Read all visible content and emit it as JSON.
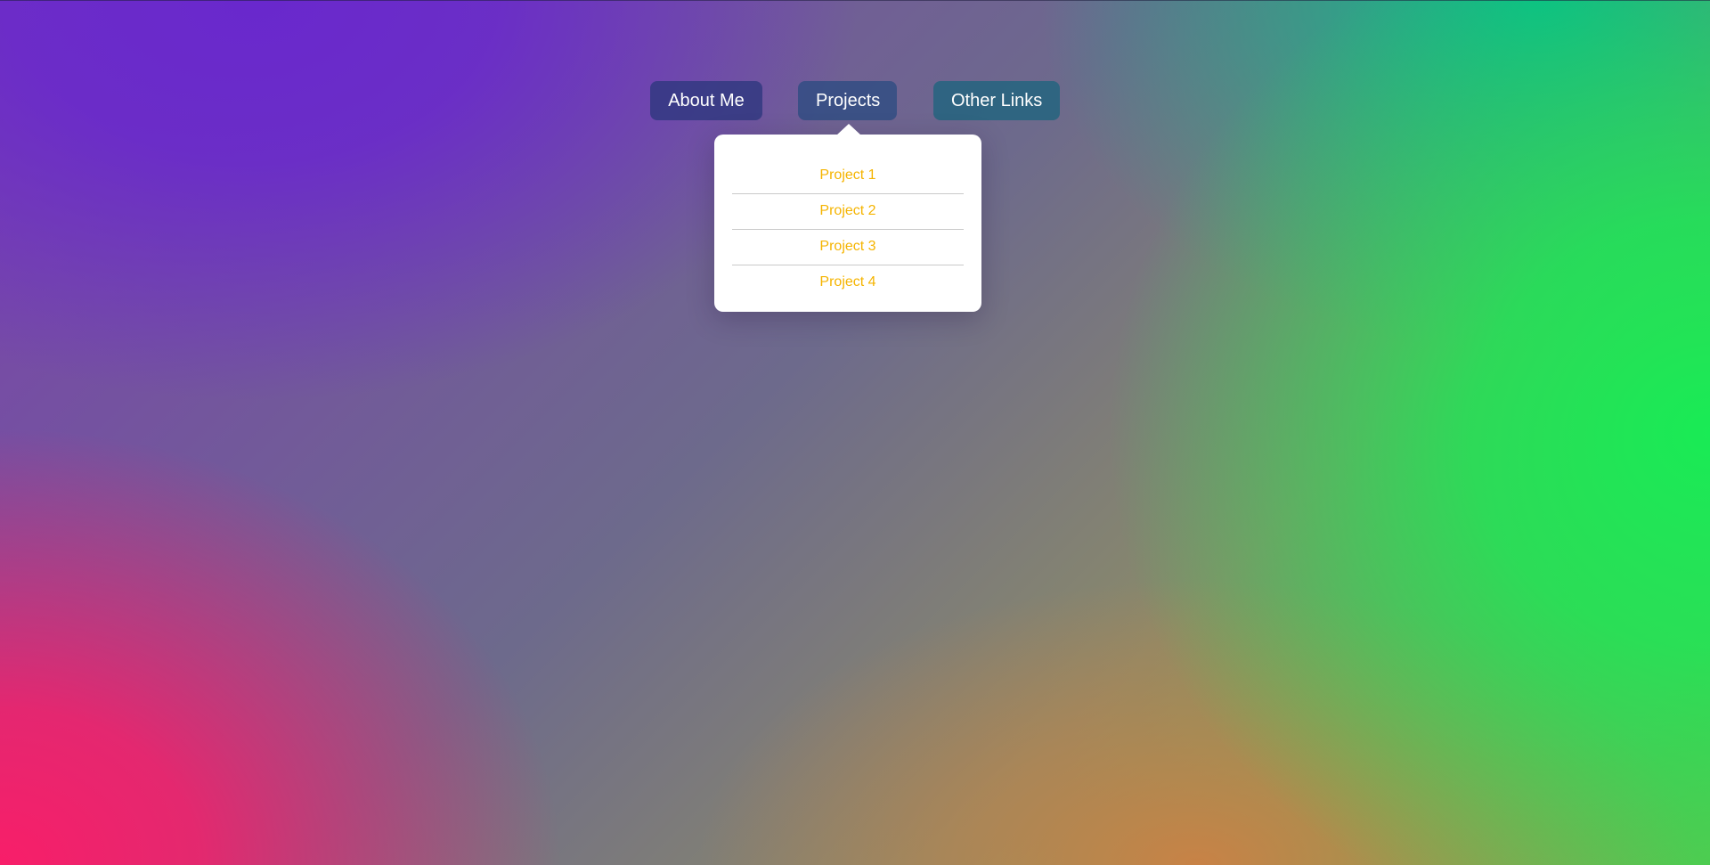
{
  "nav": {
    "items": [
      {
        "label": "About Me"
      },
      {
        "label": "Projects"
      },
      {
        "label": "Other Links"
      }
    ]
  },
  "dropdown": {
    "items": [
      {
        "label": "Project 1"
      },
      {
        "label": "Project 2"
      },
      {
        "label": "Project 3"
      },
      {
        "label": "Project 4"
      }
    ]
  },
  "colors": {
    "link": "#f5b400",
    "button_text": "#ffffff",
    "dropdown_background": "#ffffff",
    "background_pink": "#f81e69",
    "background_green": "#19eb55",
    "background_purple": "#6928cd"
  }
}
